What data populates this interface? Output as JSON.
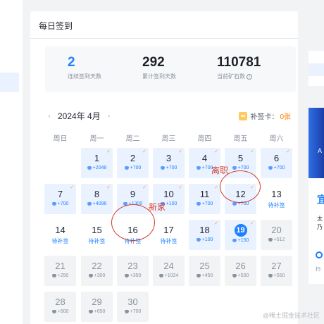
{
  "panel": {
    "title": "每日签到"
  },
  "stats": [
    {
      "value": "2",
      "label": "连续签到天数",
      "info": false
    },
    {
      "value": "292",
      "label": "累计签到天数",
      "info": false
    },
    {
      "value": "110781",
      "label": "当前矿石数",
      "info": true
    }
  ],
  "calendar_header": {
    "month": "2024年 4月",
    "prev_icon": "‹",
    "next_icon": "›",
    "supplement_label": "补签卡：",
    "supplement_count": "0张"
  },
  "weekdays": [
    "周日",
    "周一",
    "周二",
    "周三",
    "周四",
    "周五",
    "周六"
  ],
  "days": [
    {
      "d": "1",
      "sub": "+2048",
      "state": "signed"
    },
    {
      "d": "2",
      "sub": "+700",
      "state": "signed"
    },
    {
      "d": "3",
      "sub": "+700",
      "state": "signed"
    },
    {
      "d": "4",
      "sub": "+700",
      "state": "signed"
    },
    {
      "d": "5",
      "sub": "+700",
      "state": "signed"
    },
    {
      "d": "6",
      "sub": "+700",
      "state": "signed"
    },
    {
      "d": "7",
      "sub": "+700",
      "state": "signed"
    },
    {
      "d": "8",
      "sub": "+4096",
      "state": "signed"
    },
    {
      "d": "9",
      "sub": "+1300",
      "state": "signed"
    },
    {
      "d": "10",
      "sub": "+100",
      "state": "signed"
    },
    {
      "d": "11",
      "sub": "+700",
      "state": "signed"
    },
    {
      "d": "12",
      "sub": "+700",
      "state": "signed"
    },
    {
      "d": "13",
      "sub": "待补签",
      "state": "missed"
    },
    {
      "d": "14",
      "sub": "待补签",
      "state": "missed"
    },
    {
      "d": "15",
      "sub": "待补签",
      "state": "missed"
    },
    {
      "d": "16",
      "sub": "待补签",
      "state": "missed"
    },
    {
      "d": "17",
      "sub": "待补签",
      "state": "missed"
    },
    {
      "d": "18",
      "sub": "+100",
      "state": "signed"
    },
    {
      "d": "19",
      "sub": "+150",
      "state": "today"
    },
    {
      "d": "20",
      "sub": "+512",
      "state": "future"
    },
    {
      "d": "21",
      "sub": "+250",
      "state": "future"
    },
    {
      "d": "22",
      "sub": "+300",
      "state": "future"
    },
    {
      "d": "23",
      "sub": "+350",
      "state": "future"
    },
    {
      "d": "24",
      "sub": "+1024",
      "state": "future"
    },
    {
      "d": "25",
      "sub": "+450",
      "state": "future"
    },
    {
      "d": "26",
      "sub": "+500",
      "state": "future"
    },
    {
      "d": "27",
      "sub": "+550",
      "state": "future"
    },
    {
      "d": "28",
      "sub": "+600",
      "state": "future"
    },
    {
      "d": "29",
      "sub": "+650",
      "state": "future"
    },
    {
      "d": "30",
      "sub": "+700",
      "state": "future"
    }
  ],
  "annotations": [
    {
      "text": "离职",
      "target_day": "12"
    },
    {
      "text": "新家",
      "target_day": "16"
    }
  ],
  "right_column": {
    "ad_letter": "A",
    "card_big": "宜",
    "card_small1": "太",
    "card_small2": "乃",
    "scan_text": "扫"
  },
  "watermark": "@稀土掘金技术社区",
  "colors": {
    "accent": "#1e80ff",
    "signed_bg": "#eaf2ff",
    "future_bg": "#f2f3f5",
    "check": "#ff9a2e",
    "annotation": "#d33b2b"
  }
}
